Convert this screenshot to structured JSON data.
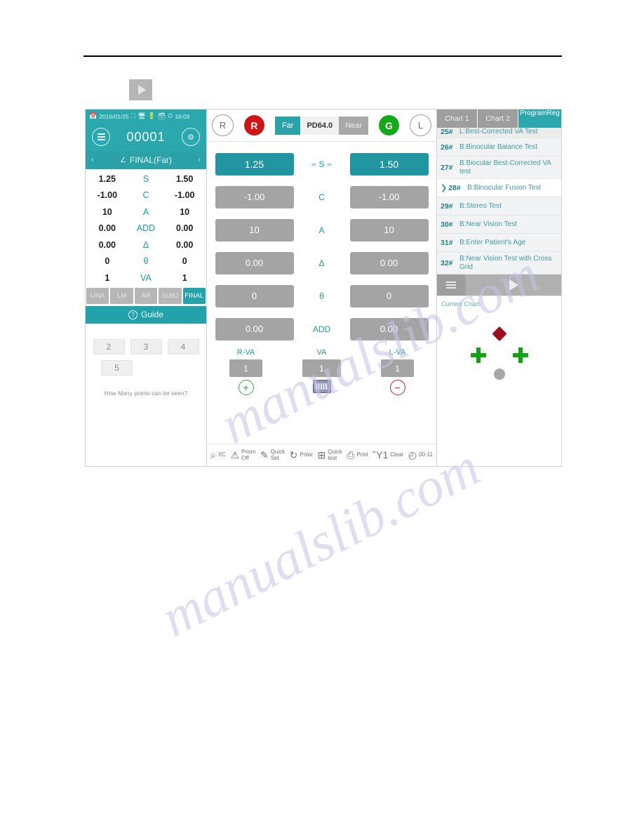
{
  "float_play": {
    "icon": "play-icon"
  },
  "left_panel": {
    "statusbar": {
      "date": "2016/01/25",
      "time": "16:09",
      "icons": [
        "calendar-icon",
        "network-icon",
        "monitor-icon",
        "battery-icon",
        "card-icon",
        "clock-icon"
      ]
    },
    "patient_id": "00001",
    "menu_icon": "hamburger-menu-icon",
    "settings_icon": "gear-icon",
    "final_bar": {
      "prev": "‹",
      "title": "FINAL(Far)",
      "next": "›",
      "share_icon": "share-icon"
    },
    "rx_rows": [
      {
        "left": "1.25",
        "label": "S",
        "right": "1.50"
      },
      {
        "left": "-1.00",
        "label": "C",
        "right": "-1.00"
      },
      {
        "left": "10",
        "label": "A",
        "right": "10"
      },
      {
        "left": "0.00",
        "label": "ADD",
        "right": "0.00"
      },
      {
        "left": "0.00",
        "label": "Δ",
        "right": "0.00"
      },
      {
        "left": "0",
        "label": "θ",
        "right": "0"
      },
      {
        "left": "1",
        "label": "VA",
        "right": "1"
      }
    ],
    "mode_buttons": [
      {
        "label": "UNA",
        "active": false
      },
      {
        "label": "LM",
        "active": false
      },
      {
        "label": "AR",
        "active": false
      },
      {
        "label": "SUBJ",
        "active": false
      },
      {
        "label": "FINAL",
        "active": true
      }
    ],
    "guide_label": "Guide",
    "answer_buttons": [
      "2",
      "3",
      "4",
      "5"
    ],
    "question_text": "How Many points can be seen?"
  },
  "center_panel": {
    "eye_left_outline": "R",
    "eye_red": "R",
    "eye_green": "G",
    "eye_right_outline": "L",
    "distance_far": "Far",
    "pd_value": "PD64.0",
    "distance_near": "Near",
    "value_rows": [
      {
        "left": "1.25",
        "label": "S",
        "right": "1.50",
        "highlight": true,
        "linked": true
      },
      {
        "left": "-1.00",
        "label": "C",
        "right": "-1.00",
        "highlight": false,
        "linked": false
      },
      {
        "left": "10",
        "label": "A",
        "right": "10",
        "highlight": false,
        "linked": false
      },
      {
        "left": "0.00",
        "label": "Δ",
        "right": "0.00",
        "highlight": false,
        "linked": false
      },
      {
        "left": "0",
        "label": "θ",
        "right": "0",
        "highlight": false,
        "linked": false
      },
      {
        "left": "0.00",
        "label": "ADD",
        "right": "0.00",
        "highlight": false,
        "linked": false
      }
    ],
    "va": {
      "right_label": "R-VA",
      "right_value": "1",
      "center_label": "VA",
      "center_value": "1",
      "left_label": "L-VA",
      "left_value": "1",
      "plus_icon": "plus-circle-icon",
      "keyboard_icon": "keyboard-icon",
      "minus_icon": "minus-circle-icon"
    },
    "toolbar": [
      {
        "label": "XC",
        "label2": "",
        "icon": "magnifier-xc-icon"
      },
      {
        "label": "Prism",
        "label2": "Off",
        "icon": "prism-off-icon"
      },
      {
        "label": "Quick",
        "label2": "Set",
        "icon": "quick-set-icon"
      },
      {
        "label": "Polar",
        "label2": "",
        "icon": "polar-refresh-icon"
      },
      {
        "label": "Quick",
        "label2": "test",
        "icon": "quick-test-grid-icon"
      },
      {
        "label": "Print",
        "label2": "",
        "icon": "printer-icon"
      },
      {
        "label": "Clear",
        "label2": "",
        "icon": "trash-icon"
      },
      {
        "label": "00-11",
        "label2": "",
        "icon": "clock-icon"
      }
    ]
  },
  "right_panel": {
    "tabs": [
      {
        "label": "Chart 1",
        "active": false
      },
      {
        "label": "Chart 2",
        "active": false
      },
      {
        "label": "ProgramReg",
        "active": true
      }
    ],
    "tests": [
      {
        "num": "25#",
        "name": "L:Best-Corrected VA Test",
        "selected": false,
        "clipped": true
      },
      {
        "num": "26#",
        "name": "B:Binocular Balance Test",
        "selected": false,
        "clipped": false
      },
      {
        "num": "27#",
        "name": "B:Biocular Best-Corrected VA test",
        "selected": false,
        "clipped": false
      },
      {
        "num": "28#",
        "name": "B:Binocular Fusion Test",
        "selected": true,
        "clipped": false
      },
      {
        "num": "29#",
        "name": "B:Stereo Test",
        "selected": false,
        "clipped": false
      },
      {
        "num": "30#",
        "name": "B:Near Vision Test",
        "selected": false,
        "clipped": false
      },
      {
        "num": "31#",
        "name": "B:Enter Patient's Age",
        "selected": false,
        "clipped": false
      },
      {
        "num": "32#",
        "name": "B:Near Vision Test with Cross Grid",
        "selected": false,
        "clipped": true
      }
    ],
    "playbar": {
      "menu_icon": "list-menu-icon",
      "play_icon": "play-icon"
    },
    "current_chart_label": "Current Chart",
    "chart_shapes": {
      "diamond_color": "#9e0e1e",
      "cross_color": "#12a312",
      "dot_color": "#a8a8a8"
    }
  },
  "watermark": {
    "line1": "manualslib.com",
    "line2": "manualslib.com"
  }
}
